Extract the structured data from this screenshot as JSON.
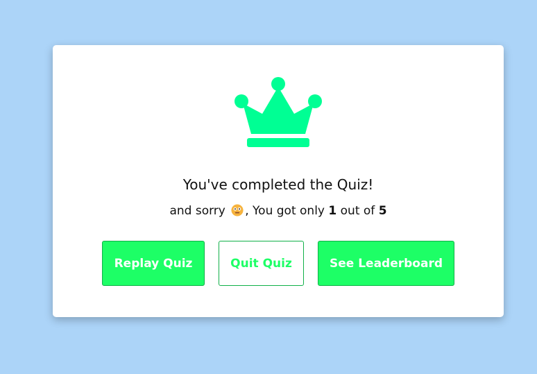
{
  "result": {
    "title": "You've completed the Quiz!",
    "prefix": "and sorry",
    "suffix": ", You got only",
    "score": "1",
    "out_of_text": "out of",
    "total": "5",
    "emoji_icon": "flushed-face-icon"
  },
  "buttons": {
    "replay": "Replay Quiz",
    "quit": "Quit Quiz",
    "leaderboard": "See Leaderboard"
  },
  "colors": {
    "background": "#acd4f8",
    "accent": "#1dff66",
    "crown": "#00ff94"
  }
}
